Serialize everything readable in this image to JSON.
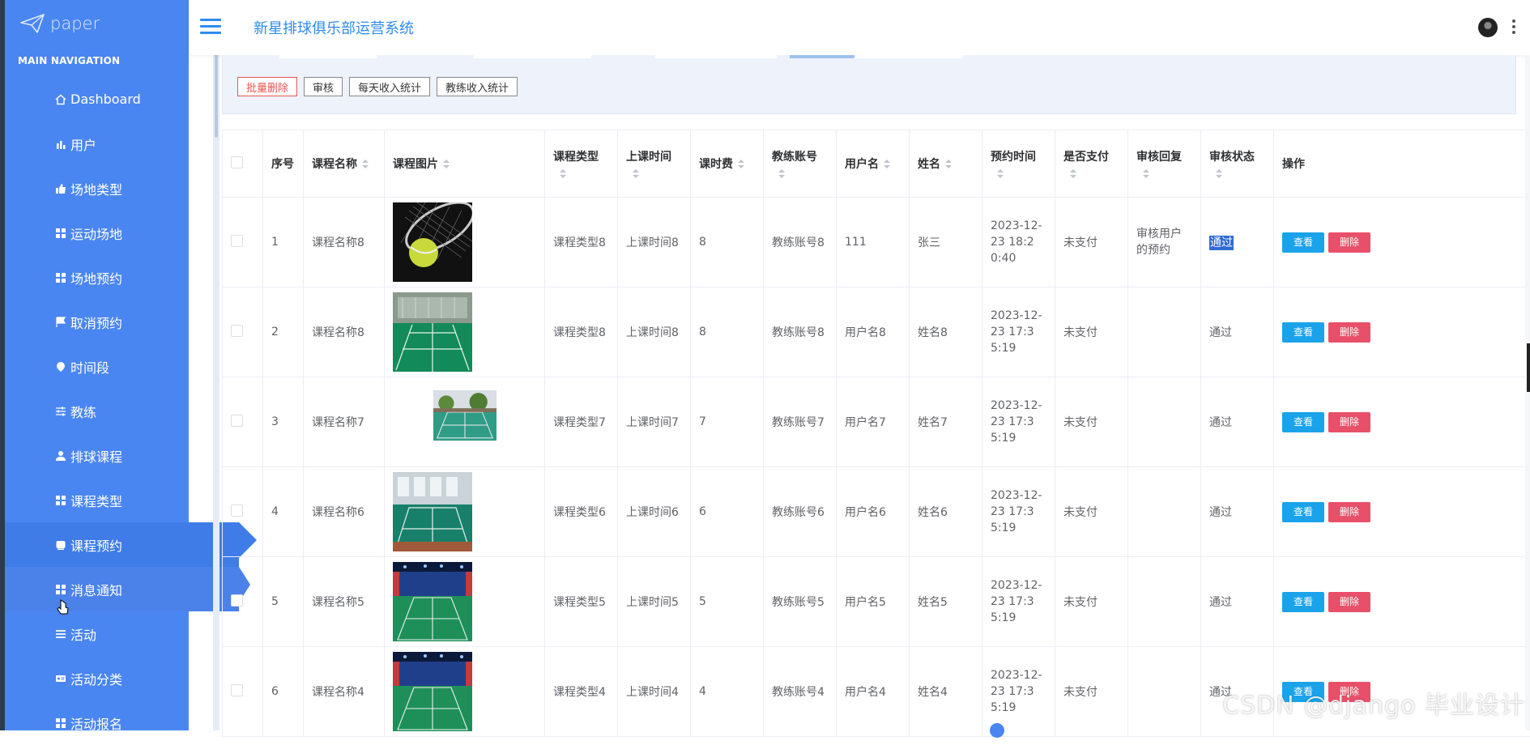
{
  "brand": {
    "name": "paper"
  },
  "header": {
    "title": "新星排球俱乐部运营系统"
  },
  "nav": {
    "heading": "MAIN NAVIGATION",
    "items": [
      {
        "label": "Dashboard",
        "icon": "home-icon"
      },
      {
        "label": "用户",
        "icon": "bar-chart-icon"
      },
      {
        "label": "场地类型",
        "icon": "thumbs-icon"
      },
      {
        "label": "运动场地",
        "icon": "grid-icon"
      },
      {
        "label": "场地预约",
        "icon": "grid-icon"
      },
      {
        "label": "取消预约",
        "icon": "flag-icon"
      },
      {
        "label": "时间段",
        "icon": "pin-icon"
      },
      {
        "label": "教练",
        "icon": "sliders-icon"
      },
      {
        "label": "排球课程",
        "icon": "user-icon"
      },
      {
        "label": "课程类型",
        "icon": "grid-icon"
      },
      {
        "label": "课程预约",
        "icon": "tablet-icon",
        "state": "active"
      },
      {
        "label": "消息通知",
        "icon": "grid-icon",
        "state": "hovered"
      },
      {
        "label": "活动",
        "icon": "list-icon"
      },
      {
        "label": "活动分类",
        "icon": "id-card-icon"
      },
      {
        "label": "活动报名",
        "icon": "grid-icon"
      }
    ]
  },
  "toolbar": {
    "batch_delete": "批量删除",
    "review": "审核",
    "daily_income": "每天收入统计",
    "coach_income": "教练收入统计"
  },
  "table": {
    "headers": {
      "index": "序号",
      "course_name": "课程名称",
      "course_image": "课程图片",
      "course_type": "课程类型",
      "class_time": "上课时间",
      "fee": "课时费",
      "coach_account": "教练账号",
      "username": "用户名",
      "real_name": "姓名",
      "booking_time": "预约时间",
      "paid": "是否支付",
      "review_reply": "审核回复",
      "review_status": "审核状态",
      "actions": "操作"
    },
    "rows": [
      {
        "index": "1",
        "course_name": "课程名称8",
        "image": "tennis-racket-ball",
        "course_type": "课程类型8",
        "class_time": "上课时间8",
        "fee": "8",
        "coach_account": "教练账号8",
        "username": "111",
        "real_name": "张三",
        "booking_time": "2023-12-23 18:20:40",
        "paid": "未支付",
        "review_reply": "审核用户的预约",
        "review_status": "通过",
        "selected_status": true
      },
      {
        "index": "2",
        "course_name": "课程名称8",
        "image": "indoor-green-court",
        "course_type": "课程类型8",
        "class_time": "上课时间8",
        "fee": "8",
        "coach_account": "教练账号8",
        "username": "用户名8",
        "real_name": "姓名8",
        "booking_time": "2023-12-23 17:35:19",
        "paid": "未支付",
        "review_reply": "",
        "review_status": "通过"
      },
      {
        "index": "3",
        "course_name": "课程名称7",
        "image": "outdoor-court",
        "course_type": "课程类型7",
        "class_time": "上课时间7",
        "fee": "7",
        "coach_account": "教练账号7",
        "username": "用户名7",
        "real_name": "姓名7",
        "booking_time": "2023-12-23 17:35:19",
        "paid": "未支付",
        "review_reply": "",
        "review_status": "通过"
      },
      {
        "index": "4",
        "course_name": "课程名称6",
        "image": "gym-court",
        "course_type": "课程类型6",
        "class_time": "上课时间6",
        "fee": "6",
        "coach_account": "教练账号6",
        "username": "用户名6",
        "real_name": "姓名6",
        "booking_time": "2023-12-23 17:35:19",
        "paid": "未支付",
        "review_reply": "",
        "review_status": "通过"
      },
      {
        "index": "5",
        "course_name": "课程名称5",
        "image": "badminton-hall",
        "course_type": "课程类型5",
        "class_time": "上课时间5",
        "fee": "5",
        "coach_account": "教练账号5",
        "username": "用户名5",
        "real_name": "姓名5",
        "booking_time": "2023-12-23 17:35:19",
        "paid": "未支付",
        "review_reply": "",
        "review_status": "通过"
      },
      {
        "index": "6",
        "course_name": "课程名称4",
        "image": "badminton-hall",
        "course_type": "课程类型4",
        "class_time": "上课时间4",
        "fee": "4",
        "coach_account": "教练账号4",
        "username": "用户名4",
        "real_name": "姓名4",
        "booking_time": "2023-12-23 17:35:19",
        "paid": "未支付",
        "review_reply": "",
        "review_status": "通过"
      }
    ],
    "view_label": "查看",
    "delete_label": "删除"
  },
  "watermark": "CSDN @django 毕业设计",
  "colors": {
    "sidebar": "#4a86f1",
    "accent": "#2d8cf0",
    "view": "#1aa3ea",
    "delete": "#e8506a"
  }
}
